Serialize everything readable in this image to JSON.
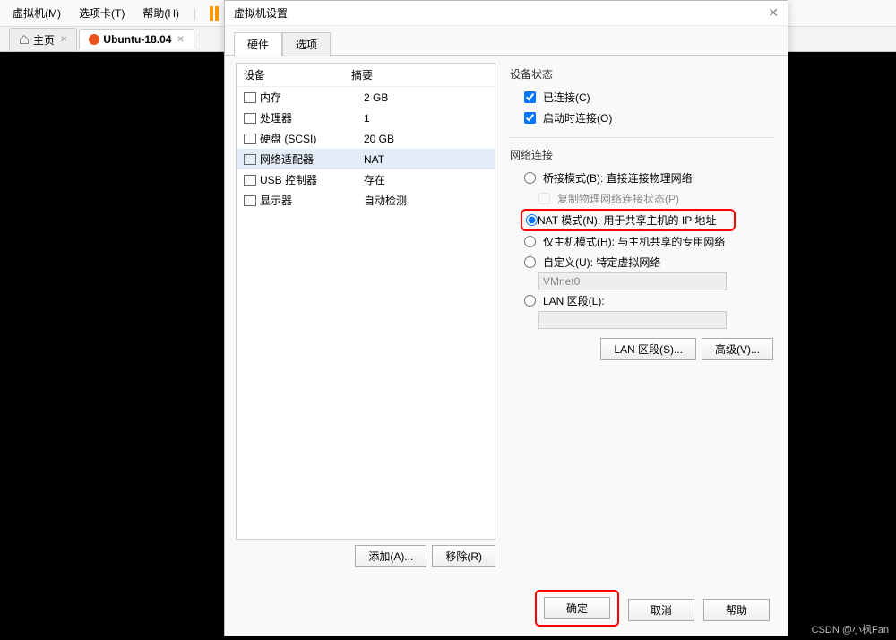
{
  "menubar": {
    "vm": "虚拟机(M)",
    "tabs": "选项卡(T)",
    "help": "帮助(H)"
  },
  "tabs": {
    "home": "主页",
    "ubuntu": "Ubuntu-18.04"
  },
  "dialog": {
    "title": "虚拟机设置",
    "tab_hardware": "硬件",
    "tab_options": "选项"
  },
  "device_list": {
    "header_device": "设备",
    "header_summary": "摘要",
    "rows": [
      {
        "name": "内存",
        "summary": "2 GB"
      },
      {
        "name": "处理器",
        "summary": "1"
      },
      {
        "name": "硬盘 (SCSI)",
        "summary": "20 GB"
      },
      {
        "name": "网络适配器",
        "summary": "NAT"
      },
      {
        "name": "USB 控制器",
        "summary": "存在"
      },
      {
        "name": "显示器",
        "summary": "自动检测"
      }
    ],
    "add_btn": "添加(A)...",
    "remove_btn": "移除(R)"
  },
  "right": {
    "device_status_title": "设备状态",
    "connected": "已连接(C)",
    "connect_at_power": "启动时连接(O)",
    "net_conn_title": "网络连接",
    "bridged": "桥接模式(B): 直接连接物理网络",
    "replicate": "复制物理网络连接状态(P)",
    "nat": "NAT 模式(N): 用于共享主机的 IP 地址",
    "host_only": "仅主机模式(H): 与主机共享的专用网络",
    "custom": "自定义(U): 特定虚拟网络",
    "vmnet": "VMnet0",
    "lan_segment": "LAN 区段(L):",
    "lan_seg_btn": "LAN 区段(S)...",
    "advanced_btn": "高级(V)..."
  },
  "footer": {
    "ok": "确定",
    "cancel": "取消",
    "help": "帮助"
  },
  "watermark": "CSDN @小枫Fan"
}
